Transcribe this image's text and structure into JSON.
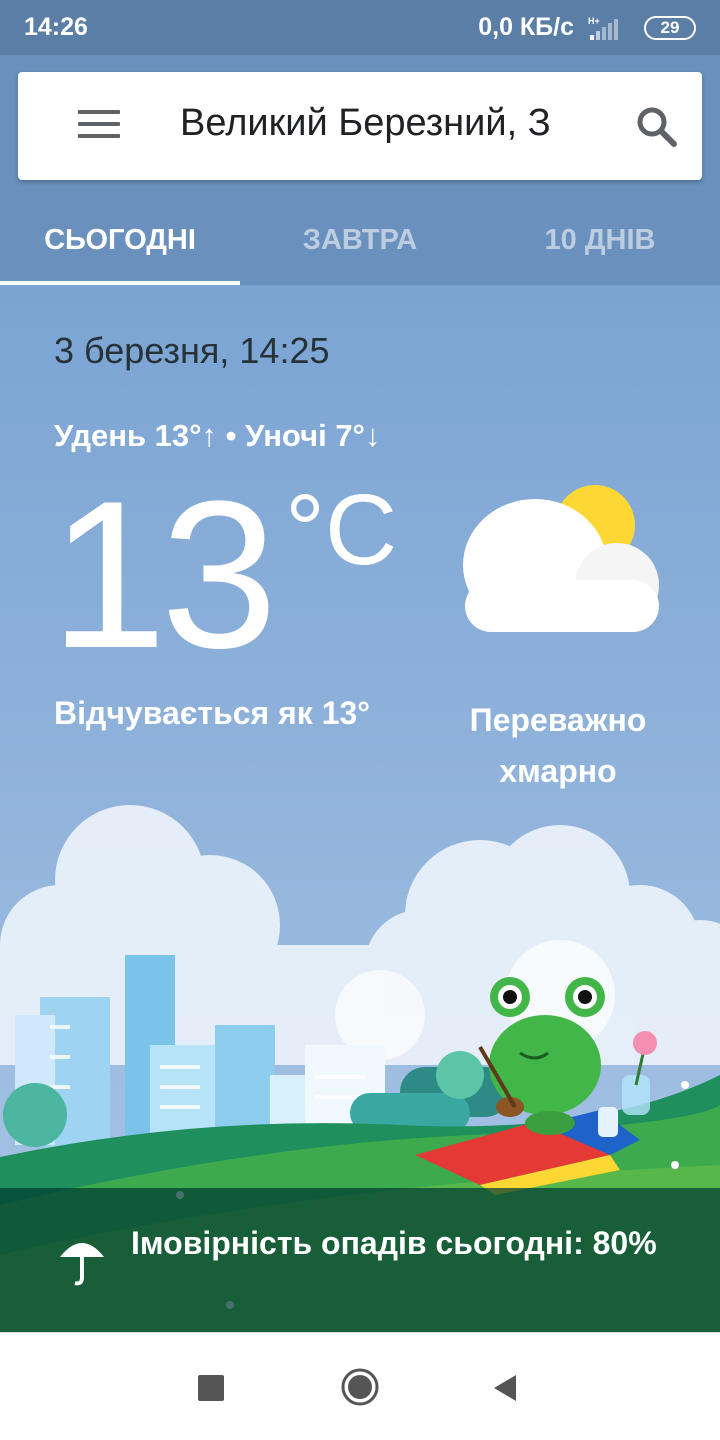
{
  "status_bar": {
    "time": "14:26",
    "net_speed": "0,0 КБ/с",
    "network_type": "H+",
    "battery": "29",
    "signal_icon": "signal-icon",
    "battery_icon": "battery-icon"
  },
  "search": {
    "location": "Великий Березний, З",
    "menu_icon": "menu-icon",
    "search_icon": "search-icon"
  },
  "tabs": [
    {
      "label": "СЬОГОДНІ",
      "active": true
    },
    {
      "label": "ЗАВТРА",
      "active": false
    },
    {
      "label": "10 ДНІВ",
      "active": false
    }
  ],
  "weather": {
    "date_time": "3 березня, 14:25",
    "hi_lo": "Удень 13°↑ • Уночі 7°↓",
    "temperature": "13",
    "unit": "°C",
    "feels_like": "Відчувається як 13°",
    "condition": "Переважно хмарно",
    "condition_icon": "partly-cloudy-icon"
  },
  "precipitation": {
    "text": "Імовірність опадів сьогодні: 80%",
    "icon": "umbrella-icon"
  },
  "nav": {
    "recent_icon": "recent-apps-icon",
    "home_icon": "home-icon",
    "back_icon": "back-icon"
  },
  "colors": {
    "status_bar": "#5a7ea6",
    "header": "#6a90bd",
    "sky_top": "#7ba4d3",
    "grass": "#3daa4e"
  }
}
